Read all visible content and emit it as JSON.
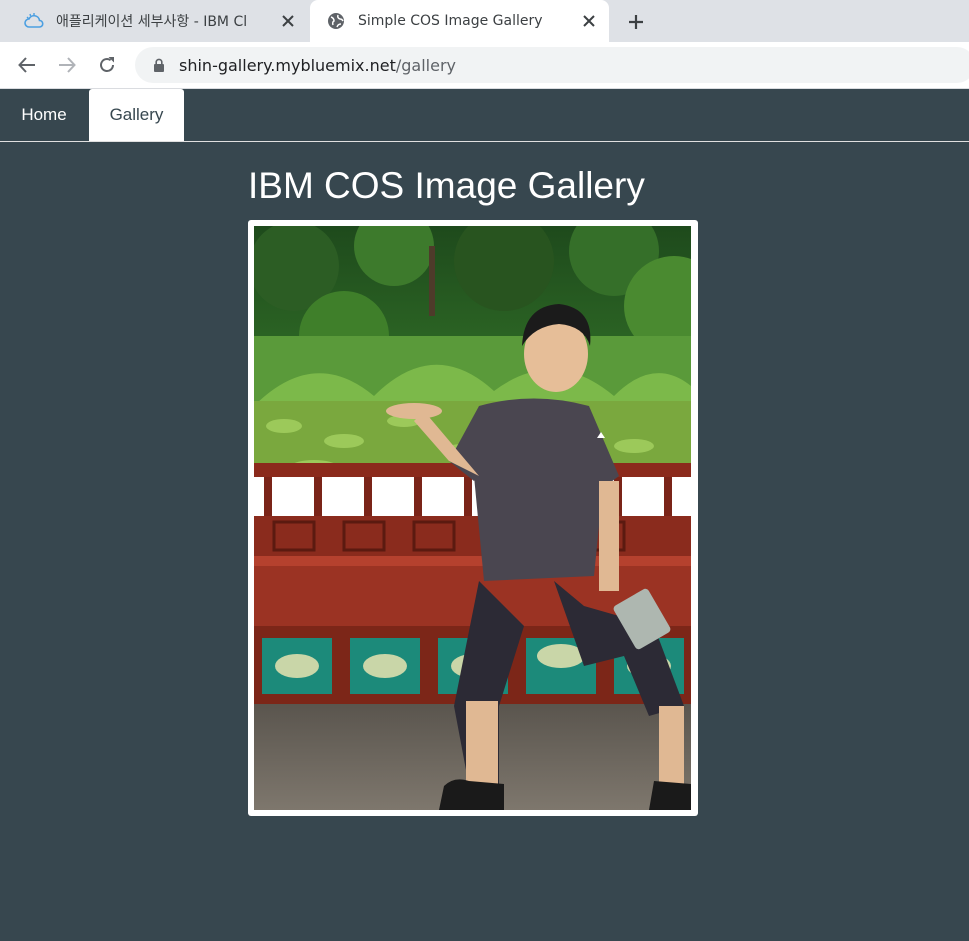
{
  "browser": {
    "tabs": [
      {
        "title": "애플리케이션 세부사항 - IBM Cl",
        "icon": "ibm-cloud-icon",
        "active": false
      },
      {
        "title": "Simple COS Image Gallery",
        "icon": "globe-icon",
        "active": true
      }
    ],
    "url": {
      "host": "shin-gallery.mybluemix.net",
      "path": "/gallery"
    }
  },
  "nav": {
    "home_label": "Home",
    "gallery_label": "Gallery"
  },
  "page": {
    "title": "IBM COS Image Gallery"
  },
  "colors": {
    "background": "#37474f",
    "active_tab": "#ffffff",
    "accent_text": "#ffffff"
  }
}
